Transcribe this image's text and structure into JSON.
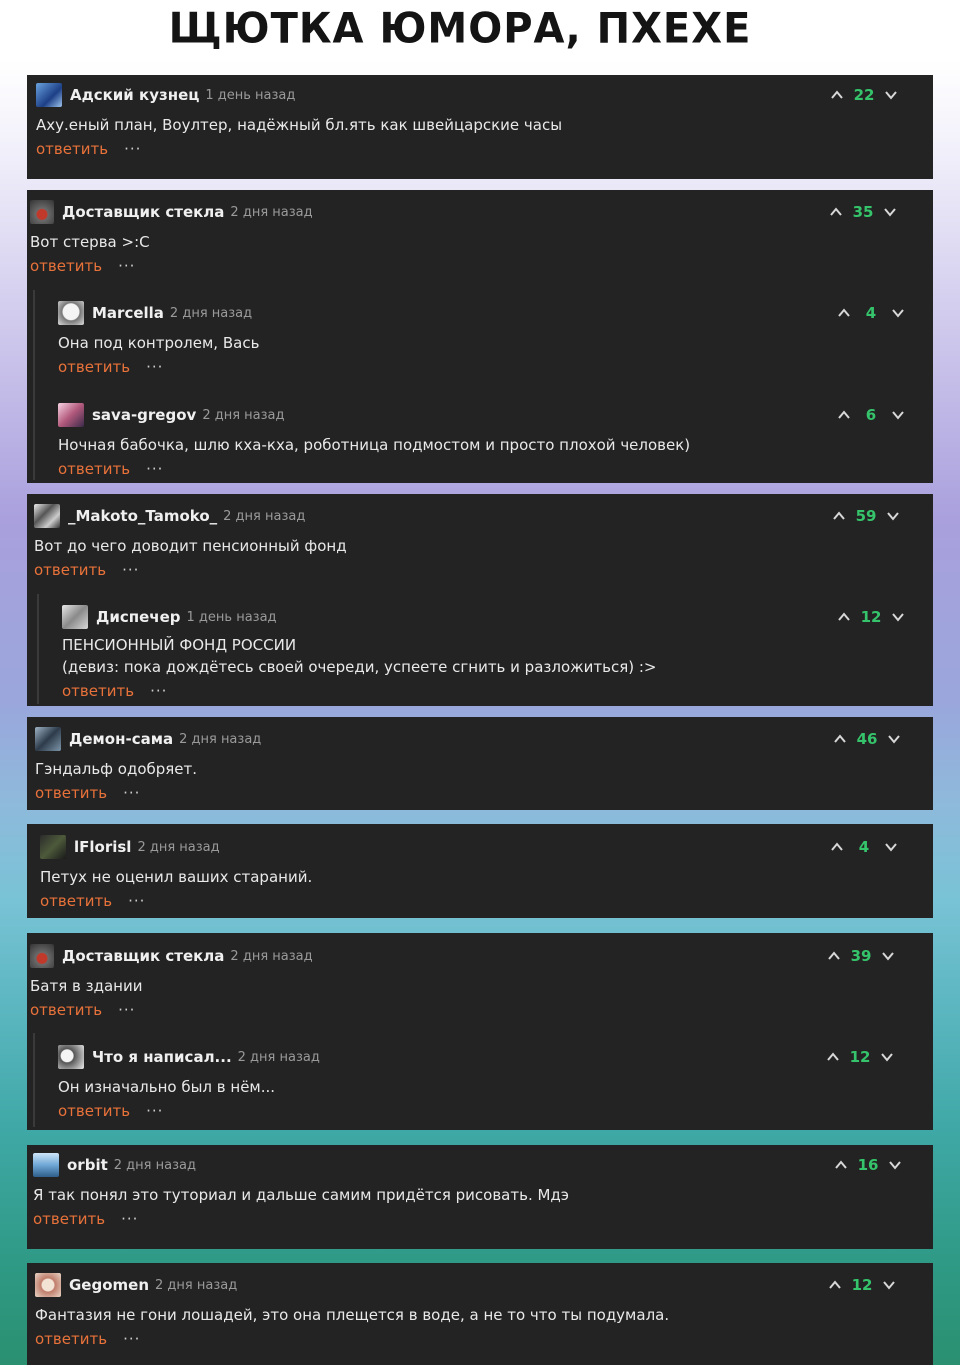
{
  "title": "ЩЮТКА ЮМОРА, ПХЕХЕ",
  "reply_label": "ответить",
  "more_label": "···",
  "colors": {
    "card_bg": "#232323",
    "reply": "#e8723a",
    "score": "#35c46b"
  },
  "threads": [
    {
      "comments": [
        {
          "author": "Адский кузнец",
          "time": "1 день назад",
          "text": "Аху.еный план, Воултер, надёжный бл.ять как швейцарские часы",
          "score": "22"
        }
      ]
    },
    {
      "comments": [
        {
          "author": "Доставщик стекла",
          "time": "2 дня назад",
          "text": "Вот стерва >:С",
          "score": "35"
        },
        {
          "author": "Marcella",
          "time": "2 дня назад",
          "text": "Она под контролем, Вась",
          "score": "4"
        },
        {
          "author": "sava-gregov",
          "time": "2 дня назад",
          "text": "Ночная бабочка, шлю кха-кха, роботница подмостом и просто плохой человек)",
          "score": "6"
        }
      ]
    },
    {
      "comments": [
        {
          "author": "_Makoto_Tamoko_",
          "time": "2 дня назад",
          "text": "Вот до чего доводит пенсионный фонд",
          "score": "59"
        },
        {
          "author": "Диспечер",
          "time": "1 день назад",
          "text": "ПЕНСИОННЫЙ ФОНД РОССИИ\n(девиз: пока дождётесь своей очереди, успеете сгнить и разложиться) :>",
          "score": "12"
        }
      ]
    },
    {
      "comments": [
        {
          "author": "Демон-сама",
          "time": "2 дня назад",
          "text": "Гэндальф одобряет.",
          "score": "46"
        }
      ]
    },
    {
      "comments": [
        {
          "author": "lFlorisl",
          "time": "2 дня назад",
          "text": "Петух не оценил ваших стараний.",
          "score": "4"
        }
      ]
    },
    {
      "comments": [
        {
          "author": "Доставщик стекла",
          "time": "2 дня назад",
          "text": "Батя в здании",
          "score": "39"
        },
        {
          "author": "Что я написал...",
          "time": "2 дня назад",
          "text": "Он изначально был в нём...",
          "score": "12"
        }
      ]
    },
    {
      "comments": [
        {
          "author": "orbit",
          "time": "2 дня назад",
          "text": "Я так понял это туториал и дальше самим придётся рисовать. Мдэ",
          "score": "16"
        }
      ]
    },
    {
      "comments": [
        {
          "author": "Gegomen",
          "time": "2 дня назад",
          "text": "Фантазия не гони лошадей, это она плещется в воде, а не то что ты подумала.",
          "score": "12"
        }
      ]
    }
  ]
}
